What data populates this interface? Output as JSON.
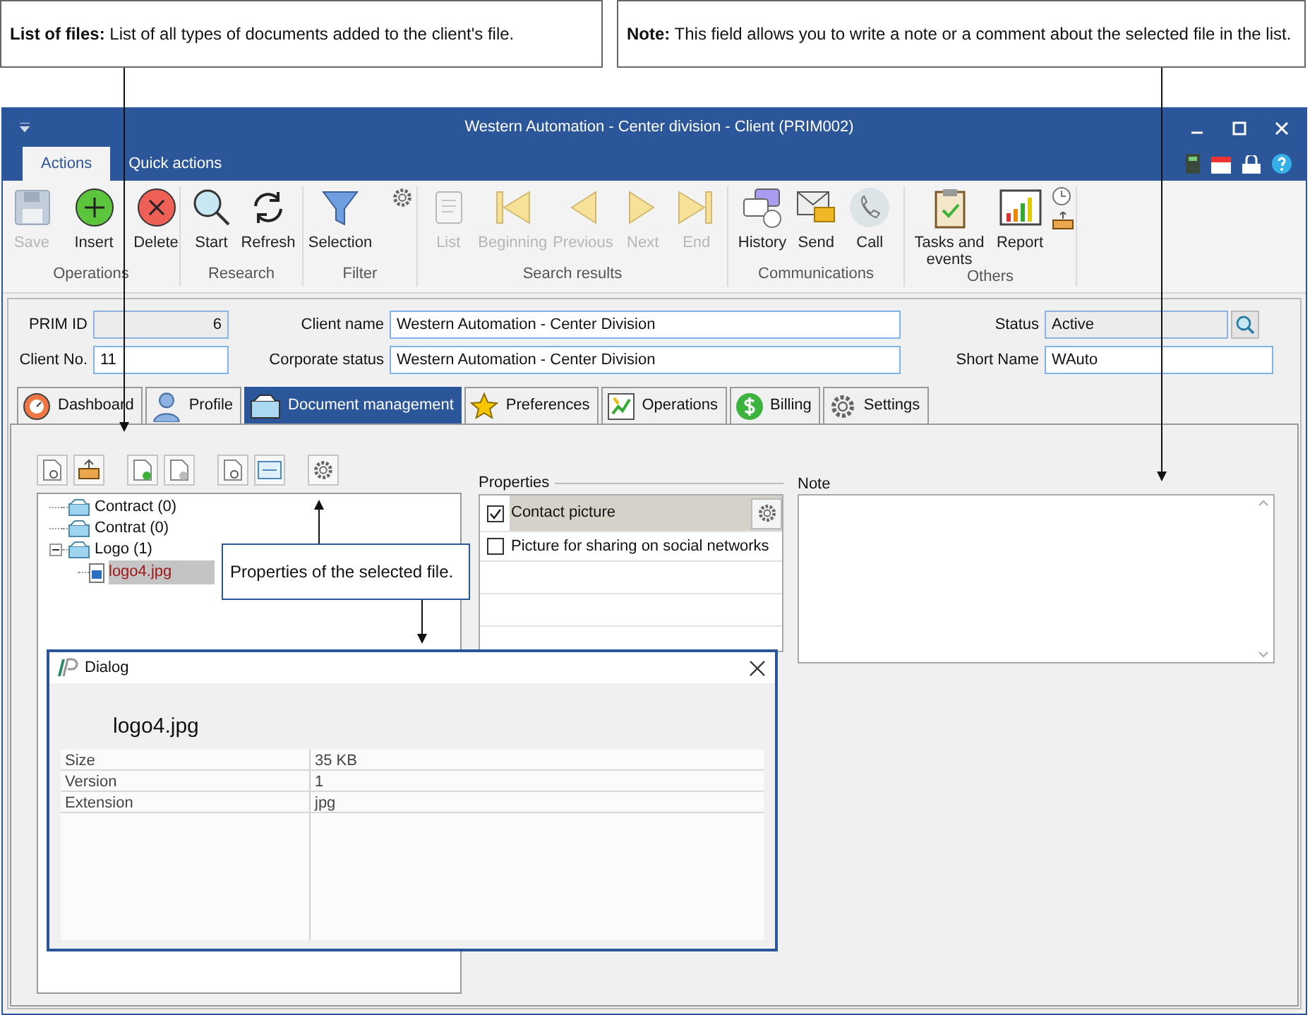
{
  "callouts": [
    {
      "text": "**List of files:** List of all types of documents added to the client's file."
    },
    {
      "text": "**Note:** This field allows you to write a note or a comment about the selected file in the list."
    },
    {
      "text": "Properties of the selected file."
    }
  ],
  "window": {
    "title": "Western Automation - Center division - Client (PRIM002)"
  },
  "ribbon_tabs": [
    {
      "label": "Actions",
      "selected": true
    },
    {
      "label": "Quick actions",
      "selected": false
    }
  ],
  "ribbon_groups": [
    {
      "label": "Operations",
      "buttons": [
        {
          "label": "Save",
          "disabled": true
        },
        {
          "label": "Insert",
          "disabled": false
        },
        {
          "label": "Delete",
          "disabled": false
        }
      ]
    },
    {
      "label": "Research",
      "buttons": [
        {
          "label": "Start",
          "disabled": false
        },
        {
          "label": "Refresh",
          "disabled": false
        }
      ]
    },
    {
      "label": "Filter",
      "buttons": [
        {
          "label": "Selection",
          "disabled": false
        }
      ]
    },
    {
      "label": "Search results",
      "buttons": [
        {
          "label": "List",
          "disabled": true
        },
        {
          "label": "Beginning",
          "disabled": true
        },
        {
          "label": "Previous",
          "disabled": true
        },
        {
          "label": "Next",
          "disabled": true
        },
        {
          "label": "End",
          "disabled": true
        }
      ]
    },
    {
      "label": "Communications",
      "buttons": [
        {
          "label": "History",
          "disabled": false
        },
        {
          "label": "Send",
          "disabled": false
        },
        {
          "label": "Call",
          "disabled": false
        }
      ]
    },
    {
      "label": "Others",
      "buttons": [
        {
          "label": "Tasks and events",
          "disabled": false
        },
        {
          "label": "Report",
          "disabled": false
        }
      ]
    }
  ],
  "fields": [
    {
      "label": "PRIM ID",
      "value": "6",
      "readonly": true
    },
    {
      "label": "Client name",
      "value": "Western Automation - Center Division",
      "readonly": false
    },
    {
      "label": "Status",
      "value": "Active",
      "readonly": true
    },
    {
      "label": "Client No.",
      "value": "11",
      "readonly": false
    },
    {
      "label": "Corporate status",
      "value": "Western Automation - Center Division",
      "readonly": false
    },
    {
      "label": "Short Name",
      "value": "WAuto",
      "readonly": false
    }
  ],
  "tabs": [
    {
      "label": "Dashboard",
      "selected": false
    },
    {
      "label": "Profile",
      "selected": false
    },
    {
      "label": "Document management",
      "selected": true
    },
    {
      "label": "Preferences",
      "selected": false
    },
    {
      "label": "Operations",
      "selected": false
    },
    {
      "label": "Billing",
      "selected": false
    },
    {
      "label": "Settings",
      "selected": false
    }
  ],
  "tree": [
    {
      "label": "Contract (0)",
      "selected": false
    },
    {
      "label": "Contrat (0)",
      "selected": false
    },
    {
      "label": "Logo (1)",
      "selected": false,
      "expanded": true,
      "children": [
        {
          "label": "logo4.jpg",
          "selected": true
        }
      ]
    }
  ],
  "properties": {
    "title": "Properties",
    "items": [
      {
        "label": "Contact picture",
        "checked": true,
        "selected": true
      },
      {
        "label": "Picture for sharing on social networks",
        "checked": false,
        "selected": false
      }
    ]
  },
  "note": {
    "label": "Note"
  },
  "dialog": {
    "title": "Dialog",
    "file_name": "logo4.jpg",
    "rows": [
      {
        "name": "Size",
        "value": "35 KB"
      },
      {
        "name": "Version",
        "value": "1"
      },
      {
        "name": "Extension",
        "value": "jpg"
      }
    ]
  }
}
